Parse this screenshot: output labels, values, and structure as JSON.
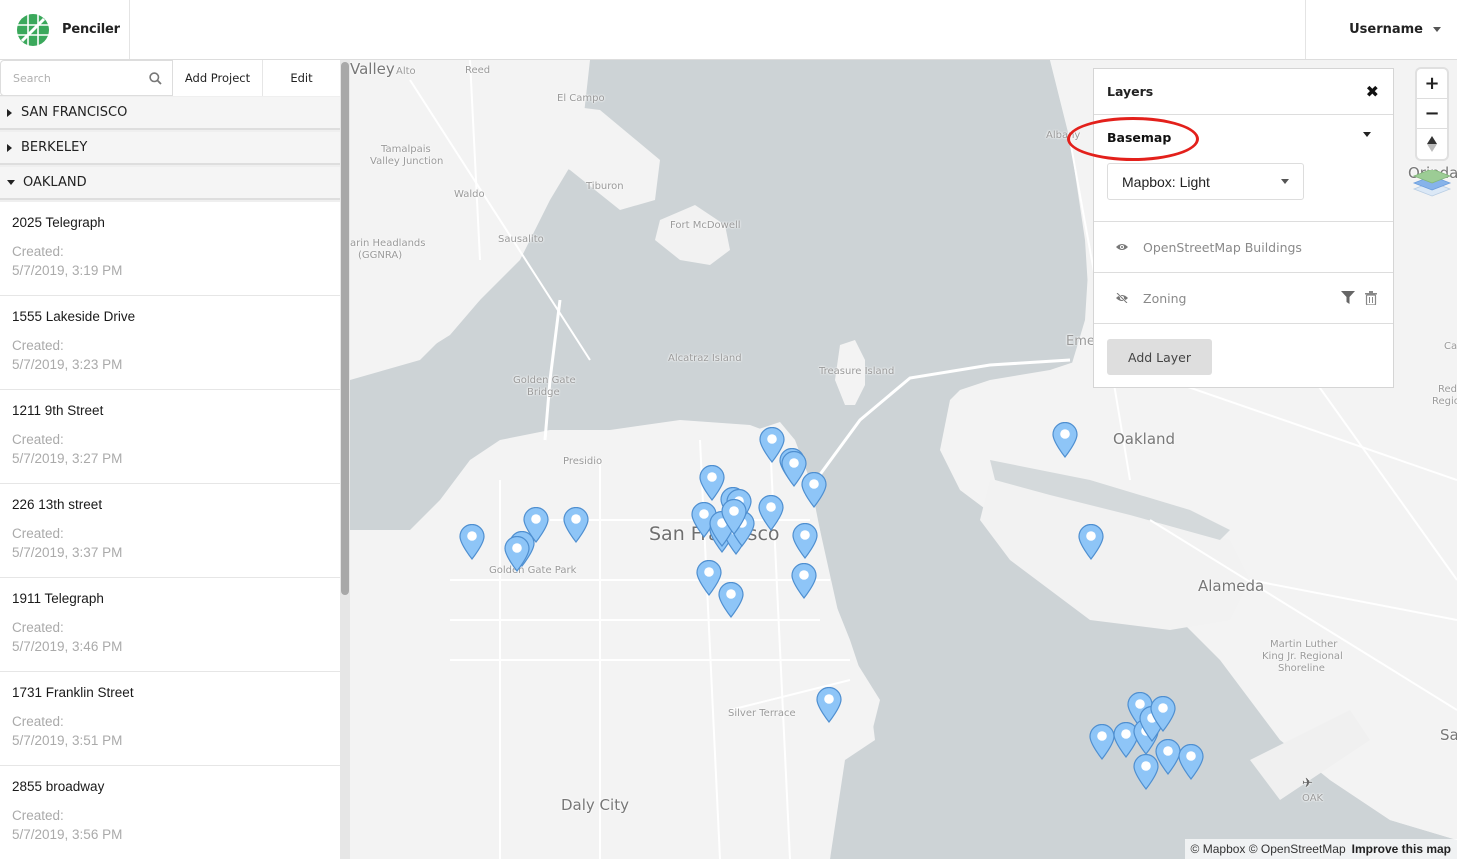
{
  "app": {
    "name": "Penciler",
    "user": "Username"
  },
  "sidebar": {
    "search_placeholder": "Search",
    "search_value": "",
    "add_project_label": "Add Project",
    "edit_label": "Edit",
    "groups": [
      {
        "name": "SAN FRANCISCO",
        "expanded": false
      },
      {
        "name": "BERKELEY",
        "expanded": false
      },
      {
        "name": "OAKLAND",
        "expanded": true
      }
    ],
    "projects": [
      {
        "name": "2025 Telegraph",
        "created_label": "Created:",
        "created": "5/7/2019, 3:19 PM"
      },
      {
        "name": "1555 Lakeside Drive",
        "created_label": "Created:",
        "created": "5/7/2019, 3:23 PM"
      },
      {
        "name": "1211 9th Street",
        "created_label": "Created:",
        "created": "5/7/2019, 3:27 PM"
      },
      {
        "name": "226 13th street",
        "created_label": "Created:",
        "created": "5/7/2019, 3:37 PM"
      },
      {
        "name": "1911 Telegraph",
        "created_label": "Created:",
        "created": "5/7/2019, 3:46 PM"
      },
      {
        "name": "1731 Franklin Street",
        "created_label": "Created:",
        "created": "5/7/2019, 3:51 PM"
      },
      {
        "name": "2855 broadway",
        "created_label": "Created:",
        "created": "5/7/2019, 3:56 PM"
      }
    ]
  },
  "layers_panel": {
    "title": "Layers",
    "basemap_title": "Basemap",
    "basemap_selected": "Mapbox: Light",
    "layers": [
      {
        "name": "OpenStreetMap Buildings",
        "visible": true,
        "has_actions": false
      },
      {
        "name": "Zoning",
        "visible": false,
        "has_actions": true
      }
    ],
    "add_layer_label": "Add Layer"
  },
  "map": {
    "labels": [
      {
        "text": "Valley"
      },
      {
        "text": "Alto"
      },
      {
        "text": "Reed"
      },
      {
        "text": "El Campo"
      },
      {
        "text": "Tamalpais"
      },
      {
        "text": "Valley Junction"
      },
      {
        "text": "Tiburon"
      },
      {
        "text": "Waldo"
      },
      {
        "text": "Fort McDowell"
      },
      {
        "text": "Sausalito"
      },
      {
        "text": "arin Headlands"
      },
      {
        "text": "(GGNRA)"
      },
      {
        "text": "Alcatraz Island"
      },
      {
        "text": "Treasure Island"
      },
      {
        "text": "Golden Gate"
      },
      {
        "text": "Bridge"
      },
      {
        "text": "Presidio"
      },
      {
        "text": "San Francisco"
      },
      {
        "text": "Golden Gate Park"
      },
      {
        "text": "Silver Terrace"
      },
      {
        "text": "Daly City"
      },
      {
        "text": "Oakland"
      },
      {
        "text": "Alameda"
      },
      {
        "text": "Eme"
      },
      {
        "text": "Martin Luther"
      },
      {
        "text": "King Jr. Regional"
      },
      {
        "text": "Shoreline"
      },
      {
        "text": "OAK"
      },
      {
        "text": "Orinda"
      },
      {
        "text": "Cany"
      },
      {
        "text": "Redw"
      },
      {
        "text": "Regional"
      },
      {
        "text": "Sa"
      },
      {
        "text": "Albany"
      }
    ],
    "marker_color": "#8ec5f7",
    "marker_count": 35,
    "zoom_in": "+",
    "zoom_out": "−",
    "compass": "▲",
    "attribution": "© Mapbox © OpenStreetMap",
    "improve_label": "Improve this map"
  },
  "colors": {
    "water": "#cdd3d6",
    "land": "#f3f3f3",
    "accent_green": "#3aa85b",
    "highlight_red": "#e3201b"
  }
}
